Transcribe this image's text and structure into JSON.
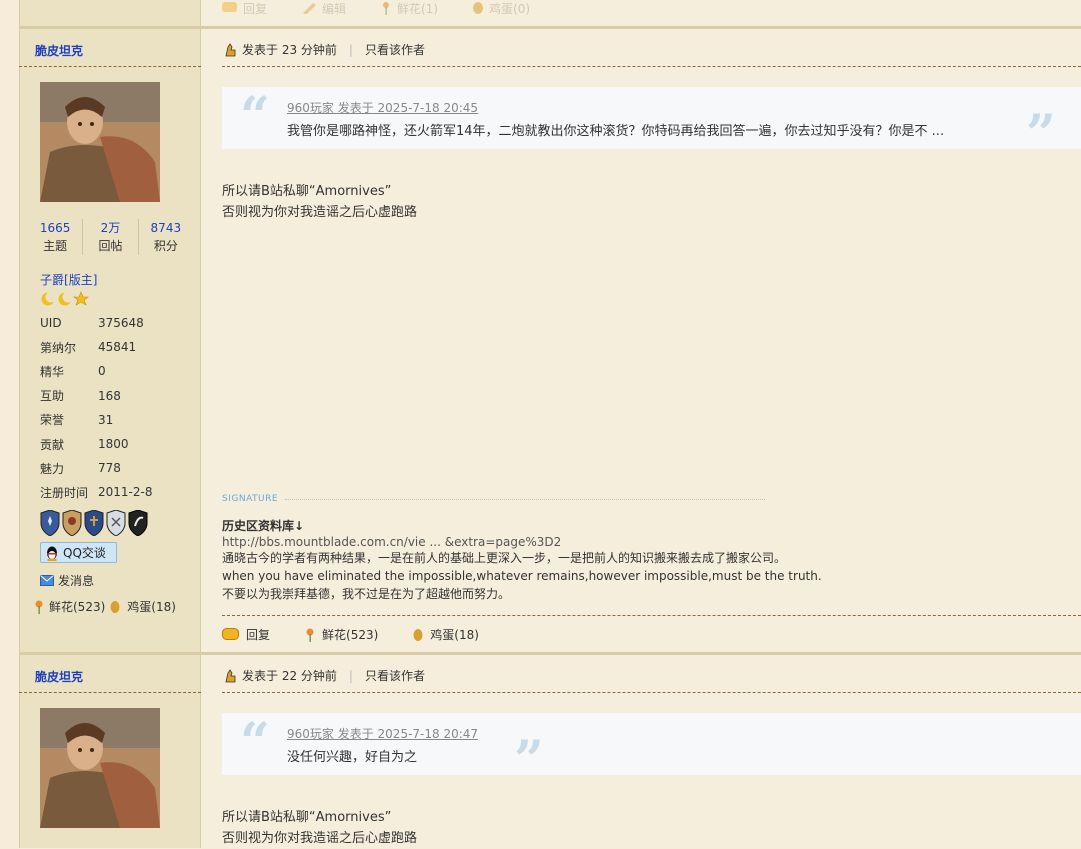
{
  "prev_post_actions": {
    "reply": "回复",
    "edit": "编辑",
    "flower": "鲜花(1)",
    "egg": "鸡蛋(0)"
  },
  "posts": [
    {
      "author": "脆皮坦克",
      "stats": [
        {
          "num": "1665",
          "label": "主题"
        },
        {
          "num": "2万",
          "label": "回帖"
        },
        {
          "num": "8743",
          "label": "积分"
        }
      ],
      "rank": "子爵",
      "rank_tag": "[版主]",
      "profile": [
        {
          "k": "UID",
          "v": "375648"
        },
        {
          "k": "第纳尔",
          "v": "45841"
        },
        {
          "k": "精华",
          "v": "0"
        },
        {
          "k": "互助",
          "v": "168"
        },
        {
          "k": "荣誉",
          "v": "31"
        },
        {
          "k": "贡献",
          "v": "1800"
        },
        {
          "k": "魅力",
          "v": "778"
        },
        {
          "k": "注册时间",
          "v": "2011-2-8"
        }
      ],
      "qq_button": "QQ交谈",
      "send_message": "发消息",
      "flowers": "鲜花(523)",
      "eggs": "鸡蛋(18)",
      "posted_time": "发表于 23 分钟前",
      "only_author": "只看该作者",
      "quote_header": "960玩家 发表于 2025-7-18 20:45",
      "quote_text": "我管你是哪路神怪，还火箭军14年，二炮就教出你这种滚货？你特码再给我回答一遍，你去过知乎没有？你是不 ...",
      "body_lines": [
        "所以请B站私聊“Amornives”",
        "否则视为你对我造谣之后心虚跑路"
      ],
      "signature_label": "SIGNATURE",
      "signature_lines": [
        "历史区资料库↓",
        "http://bbs.mountblade.com.cn/vie ... &extra=page%3D2",
        "通晓古今的学者有两种结果，一是在前人的基础上更深入一步，一是把前人的知识搬来搬去成了搬家公司。",
        "when you have eliminated the impossible,whatever remains,however impossible,must be the truth.",
        "不要以为我崇拜基德，我不过是在为了超越他而努力。"
      ],
      "actions": {
        "reply": "回复",
        "flower": "鲜花(523)",
        "egg": "鸡蛋(18)"
      }
    },
    {
      "author": "脆皮坦克",
      "posted_time": "发表于 22 分钟前",
      "only_author": "只看该作者",
      "quote_header": "960玩家 发表于 2025-7-18 20:47",
      "quote_text": "没任何兴趣，好自为之",
      "body_lines": [
        "所以请B站私聊“Amornives”",
        "否则视为你对我造谣之后心虚跑路"
      ]
    }
  ],
  "colors": {
    "author_blue": "#1e3fbf",
    "sidebar_bg": "#ebe2c4",
    "main_bg": "#f6eedc",
    "quote_bg": "#f7f8f9"
  }
}
